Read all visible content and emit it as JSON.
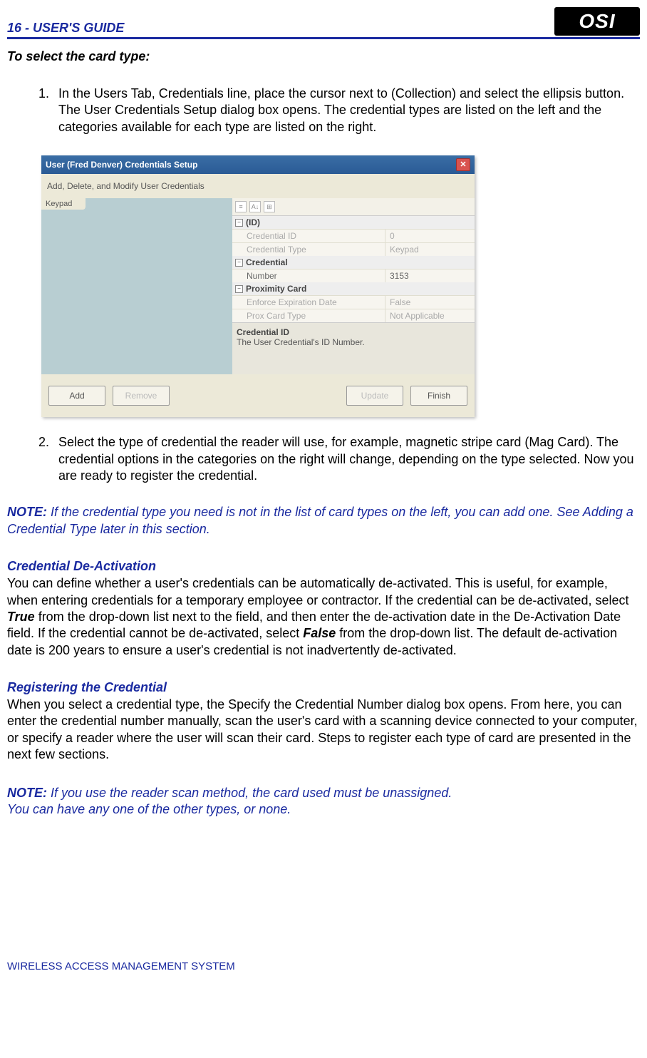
{
  "header": {
    "page_number": "16",
    "sep": " - ",
    "guide_title": "USER'S GUIDE",
    "logo_text": "OSI"
  },
  "section_title": "To select the card type:",
  "steps": [
    "In the Users Tab, Credentials line, place the cursor next to (Collection) and select the ellipsis button.   The User Credentials Setup dialog box opens.   The credential types are listed on the left and the categories available for each type are listed on the right.",
    "Select the type of credential the reader will use, for example, magnetic stripe card (Mag Card).   The credential options in the categories on the right will change, depending on the type selected.   Now you are ready to register the credential."
  ],
  "note1": {
    "label": "NOTE:",
    "body": "  If the credential type you need is not in the list of card types on the left, you can add one. See Adding a Credential Type later in this section."
  },
  "deact": {
    "heading": "Credential De-Activation",
    "body_pre": "You can define whether a user's credentials can be automatically de-activated.   This is useful, for example, when entering credentials for a temporary employee or contractor.   If the credential can be de-activated, select ",
    "true_word": "True",
    "body_mid": " from the drop-down list next to the field, and then enter the de-activation date in the De-Activation Date field. If the credential cannot be de-activated, select ",
    "false_word": "False",
    "body_post": " from the drop-down list. The default de-activation date is 200 years to ensure a user's credential is not inadvertently de-activated."
  },
  "reg": {
    "heading": "Registering the Credential",
    "body": "When you select a credential type, the Specify the Credential Number dialog box opens.   From here, you can enter the credential number manually, scan the user's card with a scanning device connected to your computer, or specify a reader where the user will scan their card.   Steps to register each type of card are presented in the next few sections."
  },
  "note2": {
    "label": "NOTE:",
    "line1": " If you use the reader scan method, the card used must be unassigned.",
    "line2": "You can have any one of the other types, or none."
  },
  "footer": "WIRELESS ACCESS MANAGEMENT SYSTEM",
  "dialog": {
    "title": "User (Fred Denver) Credentials Setup",
    "close_glyph": "✕",
    "subtitle": "Add, Delete, and Modify User Credentials",
    "left_tab": "Keypad",
    "toolbar_icons": [
      "≡",
      "A↓",
      "⊞"
    ],
    "groups": {
      "id": {
        "label": "(ID)",
        "rows": [
          {
            "k": "Credential ID",
            "v": "0"
          },
          {
            "k": "Credential Type",
            "v": "Keypad"
          }
        ]
      },
      "credential": {
        "label": "Credential",
        "rows": [
          {
            "k": "Number",
            "v": "3153"
          }
        ]
      },
      "prox": {
        "label": "Proximity Card",
        "rows": [
          {
            "k": "Enforce Expiration Date",
            "v": "False"
          },
          {
            "k": "Prox Card Type",
            "v": "Not Applicable"
          }
        ]
      }
    },
    "help": {
      "title": "Credential ID",
      "body": "The User Credential's ID Number."
    },
    "buttons": {
      "add": "Add",
      "remove": "Remove",
      "update": "Update",
      "finish": "Finish"
    }
  }
}
